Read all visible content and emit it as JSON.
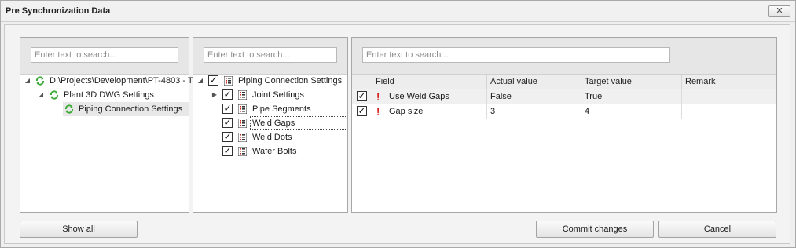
{
  "window": {
    "title": "Pre Synchronization Data",
    "close_glyph": "✕"
  },
  "left_panel": {
    "search_placeholder": "Enter text to search...",
    "tree": [
      {
        "label": "D:\\Projects\\Development\\PT-4803 - T",
        "icon": "sync-icon",
        "expanded": true
      },
      {
        "label": "Plant 3D DWG Settings",
        "icon": "sync-icon",
        "expanded": true
      },
      {
        "label": "Piping Connection Settings",
        "icon": "sync-icon",
        "selected": true
      }
    ]
  },
  "middle_panel": {
    "search_placeholder": "Enter text to search...",
    "tree": [
      {
        "label": "Piping Connection Settings",
        "checked": true,
        "expanded": true
      },
      {
        "label": "Joint Settings",
        "checked": true,
        "collapsed": true
      },
      {
        "label": "Pipe Segments",
        "checked": true
      },
      {
        "label": "Weld Gaps",
        "checked": true,
        "focused": true
      },
      {
        "label": "Weld Dots",
        "checked": true
      },
      {
        "label": "Wafer Bolts",
        "checked": true
      }
    ]
  },
  "right_panel": {
    "search_placeholder": "Enter text to search...",
    "columns": [
      "Field",
      "Actual value",
      "Target value",
      "Remark"
    ],
    "rows": [
      {
        "checked": true,
        "warning": "!",
        "field": "Use Weld Gaps",
        "actual": "False",
        "target": "True",
        "remark": ""
      },
      {
        "checked": true,
        "warning": "!",
        "field": "Gap size",
        "actual": "3",
        "target": "4",
        "remark": ""
      }
    ]
  },
  "buttons": {
    "show_all": "Show all",
    "commit": "Commit changes",
    "cancel": "Cancel"
  },
  "colors": {
    "sync_green": "#3aa935",
    "warning_red": "#d32222",
    "list_icon_red": "#cc2a1e"
  }
}
